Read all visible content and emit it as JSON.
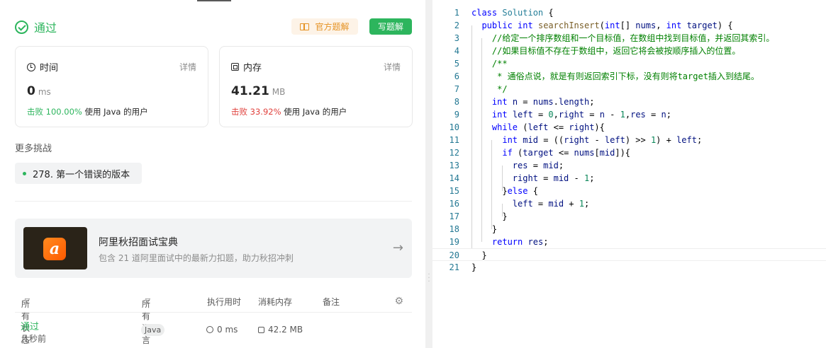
{
  "submission": {
    "status": "通过",
    "official_solution_label": "官方题解",
    "write_solution_label": "写题解"
  },
  "runtime_card": {
    "title": "时间",
    "detail_label": "详情",
    "value": "0",
    "unit": "ms",
    "beat_prefix": "击败",
    "beat_percent": "100.00%",
    "beat_suffix": "使用 Java 的用户"
  },
  "memory_card": {
    "title": "内存",
    "detail_label": "详情",
    "value": "41.21",
    "unit": "MB",
    "beat_prefix": "击败",
    "beat_percent": "33.92%",
    "beat_suffix": "使用 Java 的用户"
  },
  "more_challenges": {
    "heading": "更多挑战",
    "items": [
      "278. 第一个错误的版本"
    ]
  },
  "promo": {
    "title": "阿里秋招面试宝典",
    "subtitle": "包含 21 道阿里面试中的最新力扣题，助力秋招冲刺"
  },
  "table": {
    "headers": {
      "status": "所有状态",
      "language": "所有语言",
      "runtime": "执行用时",
      "memory": "消耗内存",
      "notes": "备注"
    },
    "rows": [
      {
        "status": "通过",
        "time_ago": "几秒前",
        "language": "Java",
        "runtime": "0 ms",
        "memory": "42.2 MB"
      }
    ]
  },
  "editor": {
    "current_line": 20,
    "line_numbers": [
      "1",
      "2",
      "3",
      "4",
      "5",
      "6",
      "7",
      "8",
      "9",
      "10",
      "11",
      "12",
      "13",
      "14",
      "15",
      "16",
      "17",
      "18",
      "19",
      "20",
      "21"
    ]
  },
  "colors": {
    "accent_green": "#2db55d",
    "warning_orange": "#e59325",
    "fail_red": "#e0403c"
  }
}
